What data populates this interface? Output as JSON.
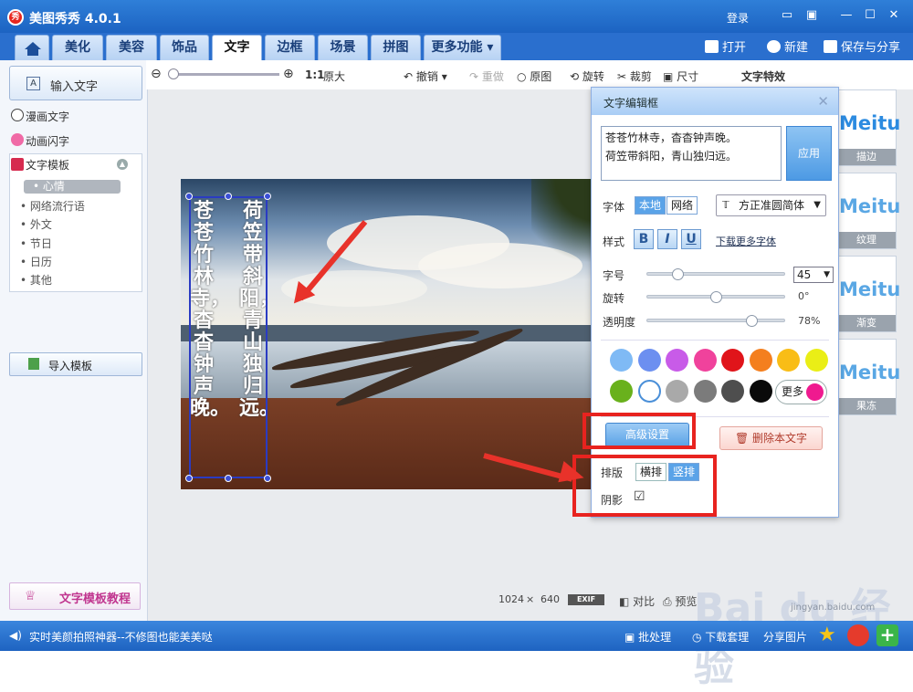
{
  "app": {
    "title": "美图秀秀 4.0.1",
    "logo": "秀",
    "login": "登录"
  },
  "tabs": [
    "美化",
    "美容",
    "饰品",
    "文字",
    "边框",
    "场景",
    "拼图",
    "更多功能"
  ],
  "top_actions": {
    "open": "打开",
    "new": "新建",
    "save": "保存与分享"
  },
  "toolbar": {
    "zoom_ratio": "1:1",
    "original_size": "原大",
    "undo": "撤销",
    "redo": "重做",
    "orig": "原图",
    "rotate": "旋转",
    "crop": "裁剪",
    "resize": "尺寸",
    "text_effects": "文字特效"
  },
  "left_panel": {
    "input_text": "输入文字",
    "comic_text": "漫画文字",
    "anim_text": "动画闪字",
    "template_header": "文字模板",
    "template_items": [
      "心情",
      "网络流行语",
      "外文",
      "节日",
      "日历",
      "其他"
    ],
    "import_template": "导入模板",
    "tutorial": "文字模板教程"
  },
  "canvas": {
    "vertical_text_right": "荷笠带斜阳，青山独归远。",
    "vertical_text_left": "苍苍竹林寺，杳杳钟声晚。",
    "image_width": "1024",
    "times": "×",
    "image_height": "640",
    "exif": "EXIF",
    "compare": "对比",
    "preview": "预览"
  },
  "effects": [
    {
      "word": "Meitu",
      "label": "描边"
    },
    {
      "word": "Meitu",
      "label": "纹理"
    },
    {
      "word": "Meitu",
      "label": "渐变"
    },
    {
      "word": "Meitu",
      "label": "果冻"
    }
  ],
  "dialog": {
    "title": "文字编辑框",
    "text_line1": "苍苍竹林寺，杳杳钟声晚。",
    "text_line2": "荷笠带斜阳，青山独归远。",
    "apply": "应用",
    "font_label": "字体",
    "font_local": "本地",
    "font_web": "网络",
    "font_name": "方正准圆简体",
    "style_label": "样式",
    "bold": "B",
    "italic": "I",
    "underline": "U",
    "download_fonts": "下载更多字体",
    "size_label": "字号",
    "size_value": "45",
    "rotate_label": "旋转",
    "rotate_value": "0°",
    "opacity_label": "透明度",
    "opacity_value": "78%",
    "colors": [
      "#7fbaf5",
      "#6c8ff0",
      "#c85be8",
      "#f0429c",
      "#e0141a",
      "#f47f1e",
      "#f9bd16",
      "#eaee16",
      "#69b11c",
      "#ffffff",
      "#a9a9a9",
      "#7b7b7b",
      "#4e4e4e",
      "#0a0a0a"
    ],
    "more_colors": "更多",
    "advanced": "高级设置",
    "delete": "删除本文字",
    "layout_label": "排版",
    "horizontal": "横排",
    "vertical": "竖排",
    "shadow_label": "阴影",
    "shadow_checked": "☑"
  },
  "status": {
    "tip": "实时美颜拍照神器--不修图也能美美哒",
    "batch": "批处理",
    "download": "下载套理",
    "share": "分享图片"
  },
  "watermark": {
    "text": "Bai du 经验",
    "url": "jingyan.baidu.com"
  }
}
